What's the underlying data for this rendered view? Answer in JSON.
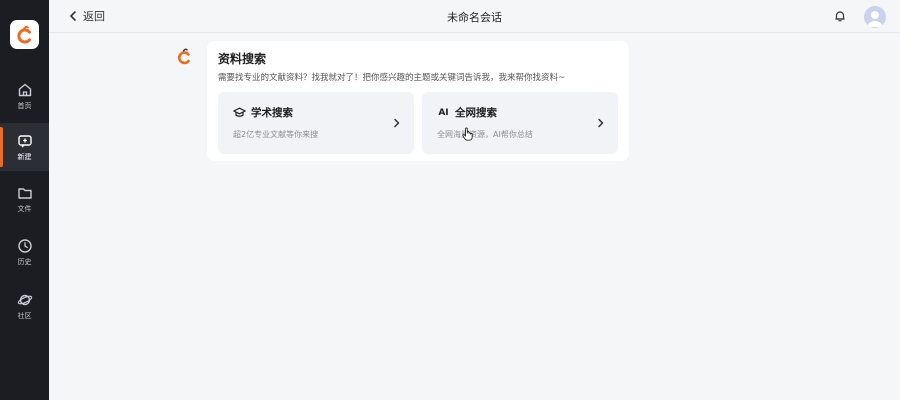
{
  "sidebar": {
    "items": [
      {
        "label": "首页",
        "icon": "home-icon"
      },
      {
        "label": "新建",
        "icon": "new-chat-icon",
        "active": true
      },
      {
        "label": "文件",
        "icon": "folder-icon"
      },
      {
        "label": "历史",
        "icon": "clock-icon"
      },
      {
        "label": "社区",
        "icon": "planet-icon"
      }
    ]
  },
  "header": {
    "back_label": "返回",
    "title": "未命名会话"
  },
  "card": {
    "title": "资料搜索",
    "desc": "需要找专业的文献资料？找我就对了！把你感兴趣的主题或关键词告诉我，我来帮你找资料~",
    "options": [
      {
        "title": "学术搜索",
        "sub": "超2亿专业文献等你来搜",
        "icon": "graduation-cap-icon"
      },
      {
        "title": "全网搜索",
        "sub": "全网海量资源，AI帮你总结",
        "icon": "ai-icon",
        "icon_text": "AI"
      }
    ]
  },
  "colors": {
    "accent": "#f26b1d",
    "sidebar_bg": "#1b1d22",
    "page_bg": "#f5f6f8"
  }
}
